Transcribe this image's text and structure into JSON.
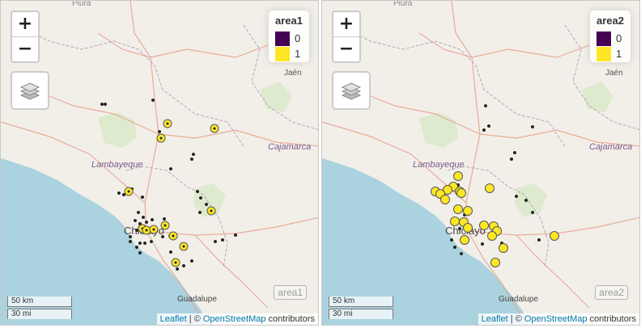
{
  "panels": [
    {
      "id": "left",
      "legend": {
        "title": "area1",
        "items": [
          {
            "label": "0",
            "color": "#440154"
          },
          {
            "label": "1",
            "color": "#fde725"
          }
        ]
      },
      "watermark": "area1"
    },
    {
      "id": "right",
      "legend": {
        "title": "area2",
        "items": [
          {
            "label": "0",
            "color": "#440154"
          },
          {
            "label": "1",
            "color": "#fde725"
          }
        ]
      },
      "watermark": "area2"
    }
  ],
  "controls": {
    "zoom_in": "+",
    "zoom_out": "−"
  },
  "scale": {
    "km": "50 km",
    "mi": "30 mi"
  },
  "attribution": {
    "leaflet": "Leaflet",
    "sep": " | © ",
    "osm": "OpenStreetMap",
    "contributors": " contributors"
  },
  "map_labels": {
    "piura": "Piura",
    "jaen": "Jaén",
    "lambayeque": "Lambayeque",
    "cajamarca": "Cajamarca",
    "chiclayo": "Chiclayo",
    "guadalupe": "Guadalupe"
  },
  "colors": {
    "land": "#f2efe9",
    "ocean": "#aad3df",
    "park": "#d8e8c5",
    "road": "#e8a08a",
    "border": "#a993b6",
    "point0": "#440154",
    "point1": "#fde725"
  }
}
